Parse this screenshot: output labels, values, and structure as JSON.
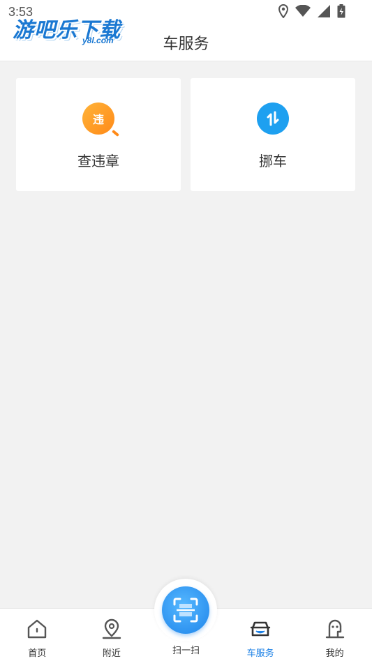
{
  "status_bar": {
    "time": "3:53"
  },
  "watermark": {
    "main": "游吧乐下载",
    "sub": "y8l.com"
  },
  "header": {
    "title": "车服务"
  },
  "services": [
    {
      "label": "查违章",
      "icon_text": "违",
      "icon": "violation-search-icon",
      "color": "#ff9a25"
    },
    {
      "label": "挪车",
      "icon": "move-car-icon",
      "color": "#1ea0f0"
    }
  ],
  "bottom_nav": {
    "items": [
      {
        "label": "首页",
        "icon": "home-icon"
      },
      {
        "label": "附近",
        "icon": "location-pin-icon"
      },
      {
        "label": "扫一扫",
        "icon": "scan-icon"
      },
      {
        "label": "车服务",
        "icon": "car-icon",
        "active": true
      },
      {
        "label": "我的",
        "icon": "user-icon"
      }
    ],
    "active_color": "#1e82e6"
  }
}
